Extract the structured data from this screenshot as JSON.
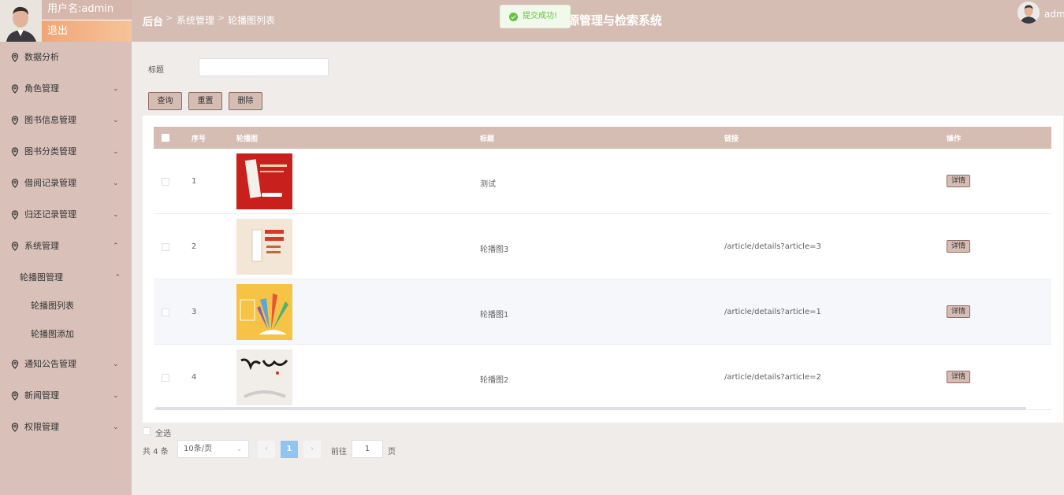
{
  "user": {
    "name_label": "用户名:admin",
    "logout_label": "退出"
  },
  "menu": [
    {
      "label": "数据分析",
      "chevron": ""
    },
    {
      "label": "角色管理",
      "chevron": "⌄"
    },
    {
      "label": "图书信息管理",
      "chevron": "⌄"
    },
    {
      "label": "图书分类管理",
      "chevron": "⌄"
    },
    {
      "label": "借阅记录管理",
      "chevron": "⌄"
    },
    {
      "label": "归还记录管理",
      "chevron": "⌄"
    },
    {
      "label": "系统管理",
      "chevron": "⌃"
    },
    {
      "label": "通知公告管理",
      "chevron": "⌄"
    },
    {
      "label": "新闻管理",
      "chevron": "⌄"
    },
    {
      "label": "权限管理",
      "chevron": "⌄"
    }
  ],
  "submenu": {
    "group_label": "轮播图管理",
    "group_chevron": "⌃",
    "items": [
      "轮播图列表",
      "轮播图添加"
    ]
  },
  "header": {
    "breadcrumb": [
      "后台",
      "系统管理",
      "轮播图列表"
    ],
    "separator": ">",
    "system_title": "源管理与检索系统",
    "toast": "提交成功!",
    "admin_label": "admi"
  },
  "search": {
    "title_label": "标题",
    "title_value": "",
    "query_button": "查询",
    "reset_button": "重置",
    "delete_button": "删除"
  },
  "table": {
    "columns": [
      "序号",
      "轮播图",
      "标题",
      "链接",
      "操作"
    ],
    "rows": [
      {
        "index": "1",
        "title": "测试",
        "link": "",
        "action": "详情"
      },
      {
        "index": "2",
        "title": "轮播图3",
        "link": "/article/details?article=3",
        "action": "详情"
      },
      {
        "index": "3",
        "title": "轮播图1",
        "link": "/article/details?article=1",
        "action": "详情"
      },
      {
        "index": "4",
        "title": "轮播图2",
        "link": "/article/details?article=2",
        "action": "详情"
      }
    ]
  },
  "footer": {
    "select_all": "全选",
    "total": "共 4 条",
    "page_size": "10条/页",
    "prev": "‹",
    "next": "›",
    "current_page": "1",
    "goto_label": "前往",
    "goto_value": "1",
    "page_suffix": "页"
  },
  "colors": {
    "sidebar": "#d9c0b9",
    "header": "#d5bdb4",
    "logout_gradient_start": "#f0a675",
    "toast_green": "#67c23a",
    "active_page": "#8fc5f2"
  }
}
